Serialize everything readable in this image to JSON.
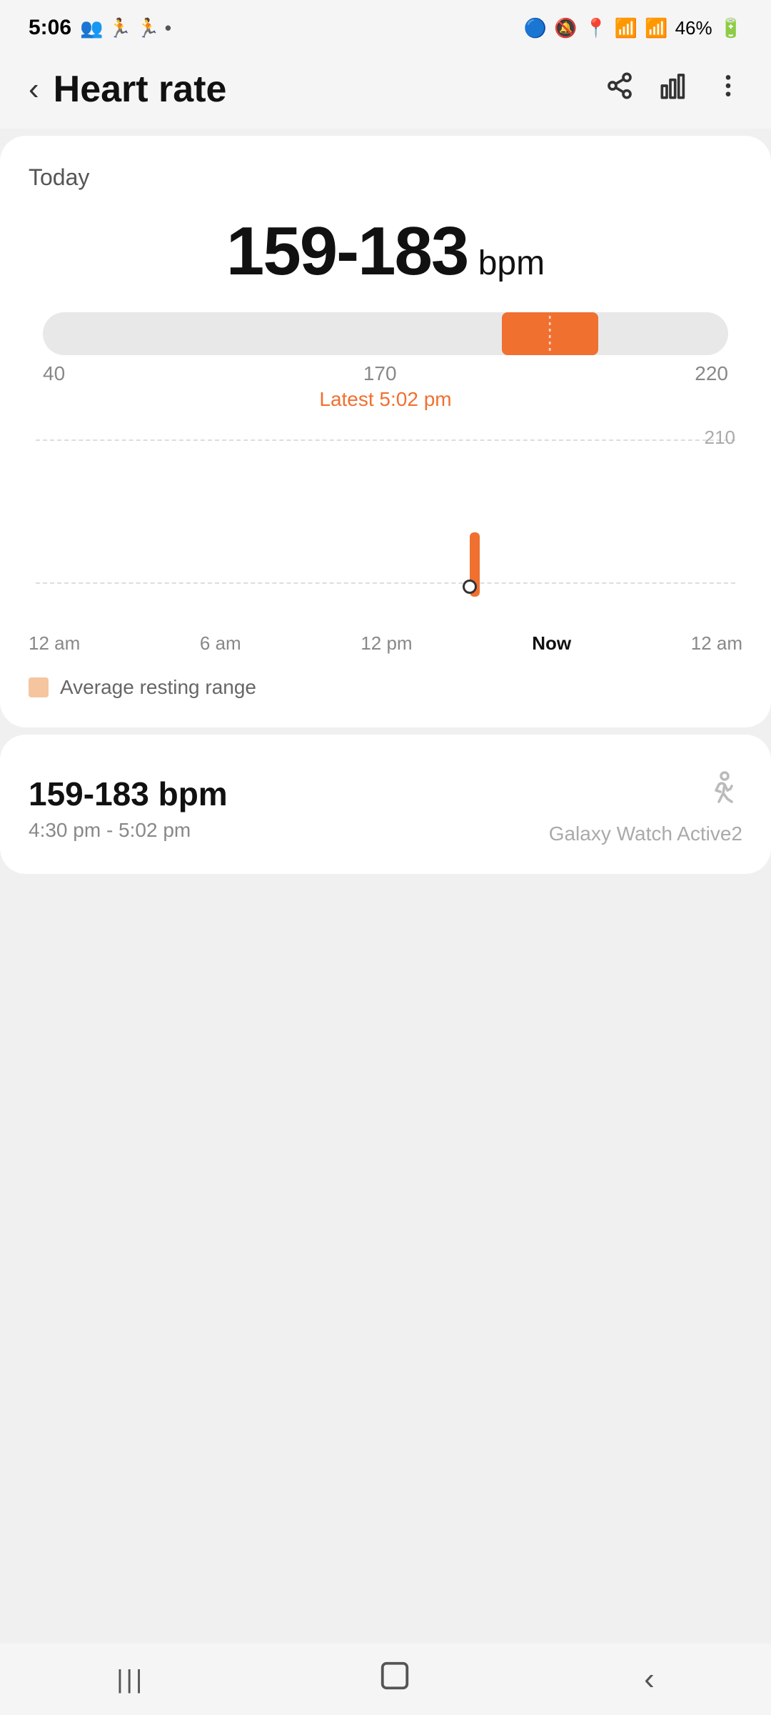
{
  "statusBar": {
    "time": "5:06",
    "batteryPercent": "46%"
  },
  "header": {
    "backLabel": "‹",
    "title": "Heart rate",
    "shareIcon": "share",
    "chartIcon": "bar-chart",
    "moreIcon": "more"
  },
  "today": {
    "label": "Today",
    "bpmRange": "159-183",
    "bpmUnit": "bpm"
  },
  "rangeBar": {
    "minLabel": "40",
    "currentValue": "170",
    "currentTime": "Latest 5:02 pm",
    "maxLabel": "220",
    "fillLeft": 67,
    "fillWidth": 14
  },
  "chart": {
    "topGridLabel": "210",
    "xLabels": [
      "12 am",
      "6 am",
      "12 pm",
      "Now",
      "12 am"
    ]
  },
  "legend": {
    "label": "Average resting range"
  },
  "detailCard": {
    "bpmRange": "159-183 bpm",
    "timeRange": "4:30 pm - 5:02 pm",
    "deviceName": "Galaxy Watch Active2"
  },
  "bottomNav": {
    "menuIcon": "|||",
    "homeIcon": "⬜",
    "backIcon": "‹"
  }
}
